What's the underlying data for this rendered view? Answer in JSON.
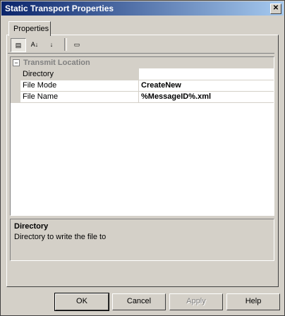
{
  "window": {
    "title": "Static Transport Properties",
    "close_glyph": "✕"
  },
  "tabs": [
    {
      "label": "Properties"
    }
  ],
  "toolbar": {
    "categorized_glyph": "▤",
    "alphabetical_glyph": "A↓",
    "grouped_glyph": "↓",
    "pages_glyph": "▭"
  },
  "category": {
    "toggle": "−",
    "label": "Transmit Location"
  },
  "properties": [
    {
      "name": "Directory",
      "value": ""
    },
    {
      "name": "File Mode",
      "value": "CreateNew"
    },
    {
      "name": "File Name",
      "value": "%MessageID%.xml"
    }
  ],
  "description": {
    "title": "Directory",
    "text": "Directory to write the file to"
  },
  "buttons": {
    "ok": "OK",
    "cancel": "Cancel",
    "apply": "Apply",
    "help": "Help"
  }
}
